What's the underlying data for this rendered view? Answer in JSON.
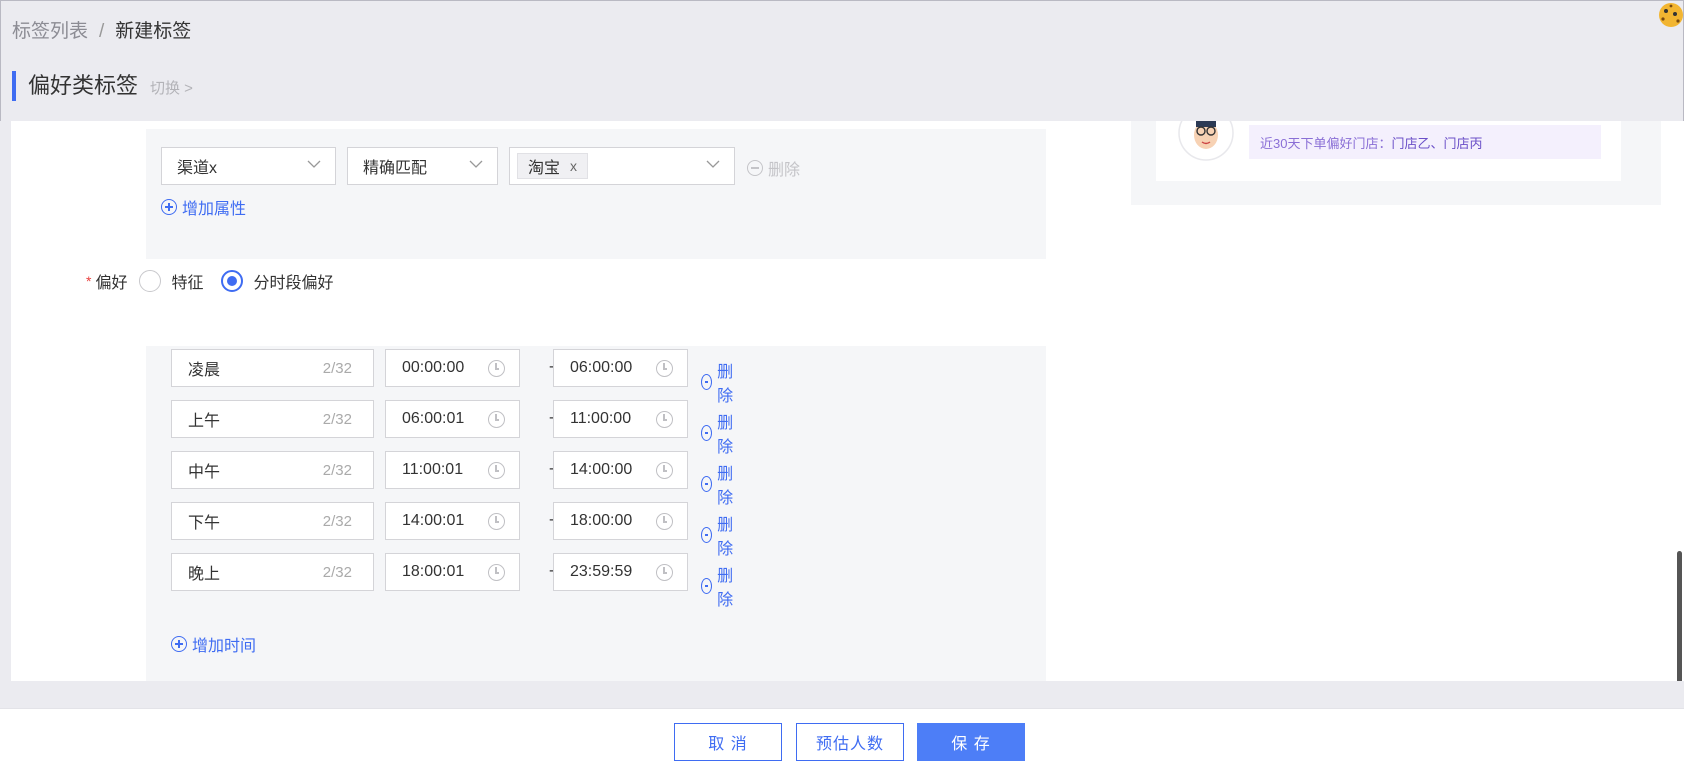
{
  "breadcrumb": {
    "parent": "标签列表",
    "separator": "/",
    "current": "新建标签"
  },
  "header": {
    "title": "偏好类标签",
    "switch_label": "切换 >"
  },
  "attributes": {
    "channel_select": "渠道x",
    "match_select": "精确匹配",
    "value_tag": "淘宝",
    "tag_remove": "x",
    "delete_label": "删除",
    "add_label": "增加属性"
  },
  "preference": {
    "label": "偏好",
    "options": [
      "特征",
      "分时段偏好"
    ],
    "selected": "分时段偏好"
  },
  "time_slots": [
    {
      "name": "凌晨",
      "count": "2/32",
      "start": "00:00:00",
      "end": "06:00:00"
    },
    {
      "name": "上午",
      "count": "2/32",
      "start": "06:00:01",
      "end": "11:00:00"
    },
    {
      "name": "中午",
      "count": "2/32",
      "start": "11:00:01",
      "end": "14:00:00"
    },
    {
      "name": "下午",
      "count": "2/32",
      "start": "14:00:01",
      "end": "18:00:00"
    },
    {
      "name": "晚上",
      "count": "2/32",
      "start": "18:00:01",
      "end": "23:59:59"
    }
  ],
  "time_slot_delete": "删除",
  "time_slot_dash": "-",
  "add_time_label": "增加时间",
  "preview": {
    "note_prefix": "近30天下单偏好门店：",
    "note_stores": "门店乙、门店丙"
  },
  "footer": {
    "cancel": "取 消",
    "estimate": "预估人数",
    "save": "保 存"
  },
  "colors": {
    "accent": "#3f6cf2",
    "primary_button": "#4d7ef7",
    "required": "#e8403e"
  }
}
